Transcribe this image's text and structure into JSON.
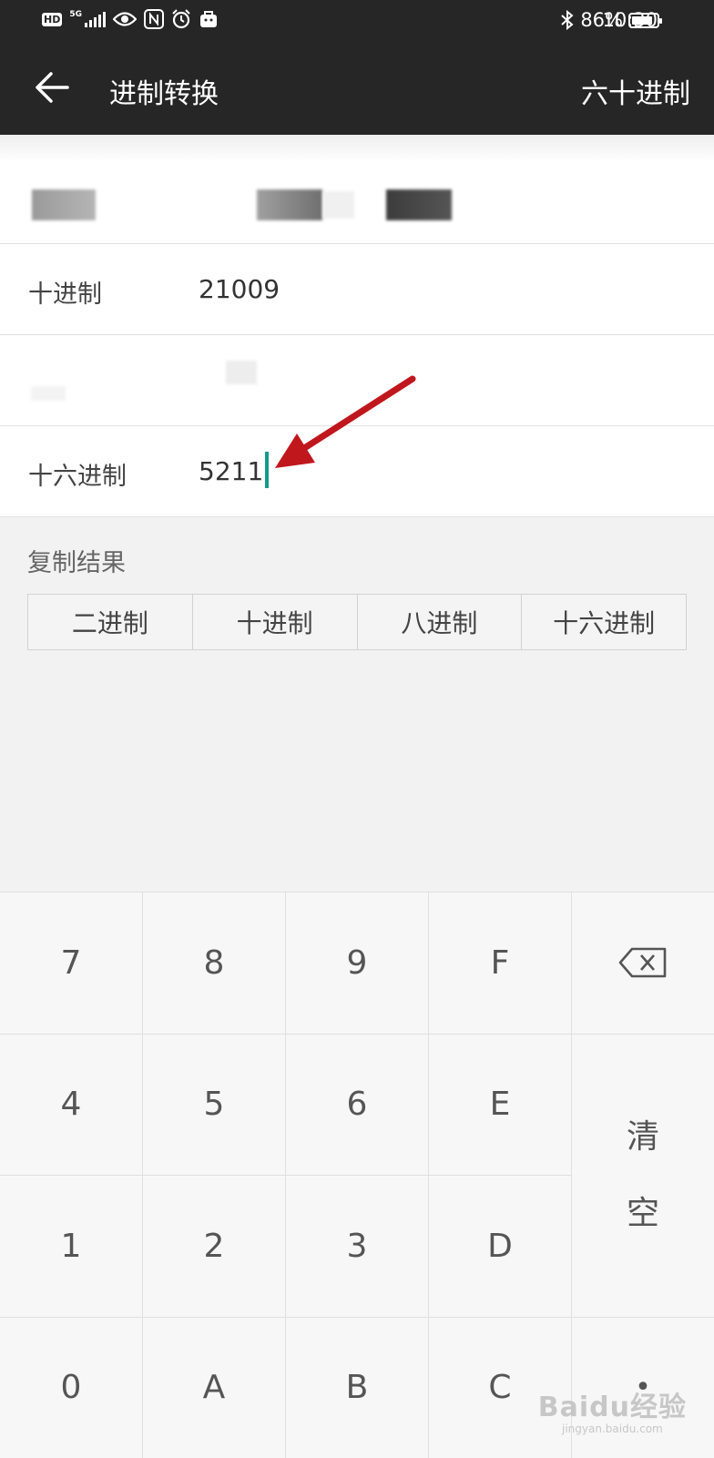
{
  "status_bar": {
    "left_icons": [
      "hd-icon",
      "5g-signal-icon",
      "eye-icon",
      "nfc-icon",
      "alarm-icon",
      "bag-icon"
    ],
    "hd_label": "HD",
    "network_label": "5G",
    "bluetooth_icon": "bluetooth-icon",
    "battery_percent": "86%",
    "battery_level": 0.86,
    "time": "10:30"
  },
  "app_bar": {
    "title": "进制转换",
    "action_label": "六十进制",
    "back_icon": "arrow-left-icon"
  },
  "rows": [
    {
      "label": "",
      "value": "",
      "blurred": true
    },
    {
      "label": "十进制",
      "value": "21009"
    },
    {
      "label": "",
      "value": "",
      "blurred": true
    },
    {
      "label": "十六进制",
      "value": "5211"
    }
  ],
  "copy": {
    "title": "复制结果",
    "buttons": [
      "二进制",
      "十进制",
      "八进制",
      "十六进制"
    ]
  },
  "keypad": {
    "row1": [
      "7",
      "8",
      "9",
      "F"
    ],
    "row2": [
      "4",
      "5",
      "6",
      "E"
    ],
    "row3": [
      "1",
      "2",
      "3",
      "D"
    ],
    "row4": [
      "0",
      "A",
      "B",
      "C",
      "•"
    ],
    "clear_label_1": "清",
    "clear_label_2": "空",
    "delete_icon": "backspace-icon"
  },
  "watermark": {
    "main": "Baidu经验",
    "sub": "jingyan.baidu.com"
  },
  "colors": {
    "bar_bg": "#262626",
    "cursor": "#149a8b",
    "annotation_arrow": "#c0171c"
  }
}
